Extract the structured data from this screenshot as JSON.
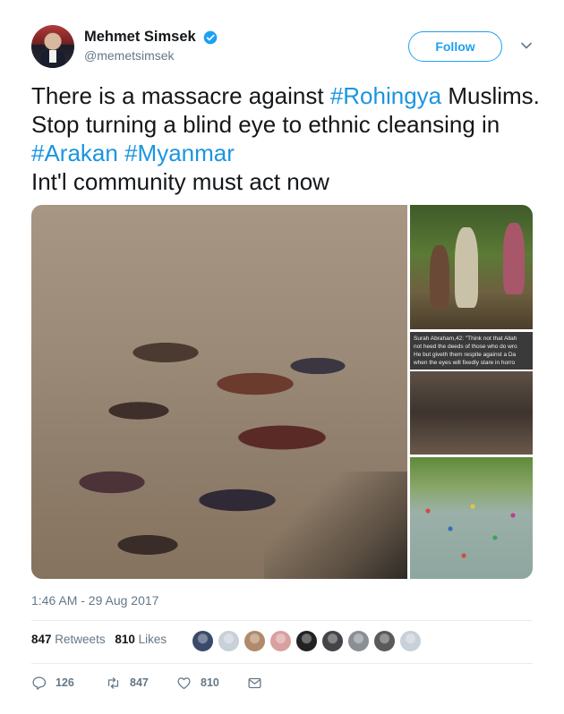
{
  "author": {
    "display_name": "Mehmet Simsek",
    "handle": "@memetsimsek",
    "verified": true
  },
  "follow_label": "Follow",
  "tweet": {
    "segments": [
      {
        "text": "There is a massacre against ",
        "hashtag": false
      },
      {
        "text": "#Rohingya",
        "hashtag": true
      },
      {
        "text": " Muslims. Stop turning a blind eye to ethnic cleansing in ",
        "hashtag": false
      },
      {
        "text": "#Arakan",
        "hashtag": true
      },
      {
        "text": " ",
        "hashtag": false
      },
      {
        "text": "#Myanmar",
        "hashtag": true
      },
      {
        "text": "\nInt'l community must act now",
        "hashtag": false
      }
    ]
  },
  "media": {
    "caption_lines": [
      "Surah Abraham,42: \"Think not that Allah",
      "not heed the deeds of those who do wro",
      "He but giveth them respite against a Da",
      "when the eyes will fixedly stare in horro"
    ]
  },
  "timestamp": "1:46 AM - 29 Aug 2017",
  "stats": {
    "retweets_count": "847",
    "retweets_label": "Retweets",
    "likes_count": "810",
    "likes_label": "Likes"
  },
  "liker_avatar_colors": [
    "#3b4a6b",
    "#c8d0d8",
    "#b08a6a",
    "#d9a0a0",
    "#222222",
    "#444448",
    "#8a8f96",
    "#5a5a5a",
    "#c8d0d8"
  ],
  "actions": {
    "reply_count": "126",
    "retweet_count": "847",
    "like_count": "810"
  },
  "colors": {
    "accent": "#1da1f2",
    "hashtag": "#1b95e0",
    "muted": "#657786"
  }
}
